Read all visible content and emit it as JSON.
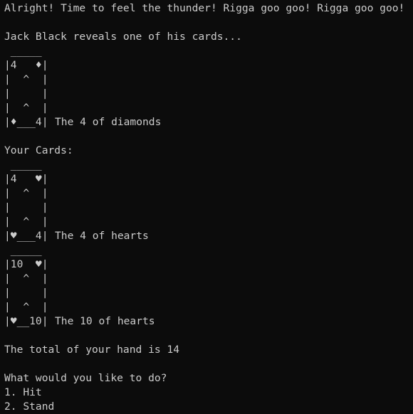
{
  "terminal": {
    "intro": "Alright! Time to feel the thunder! Rigga goo goo! Rigga goo goo!",
    "reveal": "Jack Black reveals one of his cards...",
    "dealer_card": {
      "art": " _____\n|4   ♦|\n|  ^  |\n|     |\n|  ^  |\n|♦___4|",
      "caption": "The 4 of diamonds"
    },
    "your_cards_label": "Your Cards:",
    "player_cards": [
      {
        "art": " _____\n|4   ♥|\n|  ^  |\n|     |\n|  ^  |\n|♥___4|",
        "caption": "The 4 of hearts"
      },
      {
        "art": " _____\n|10  ♥|\n|  ^  |\n|     |\n|  ^  |\n|♥__10|",
        "caption": "The 10 of hearts"
      }
    ],
    "total": "The total of your hand is 14",
    "prompt": "What would you like to do?",
    "options": [
      "1. Hit",
      "2. Stand"
    ]
  },
  "colors": {
    "background": "#0c0c0c",
    "foreground": "#cccccc"
  }
}
